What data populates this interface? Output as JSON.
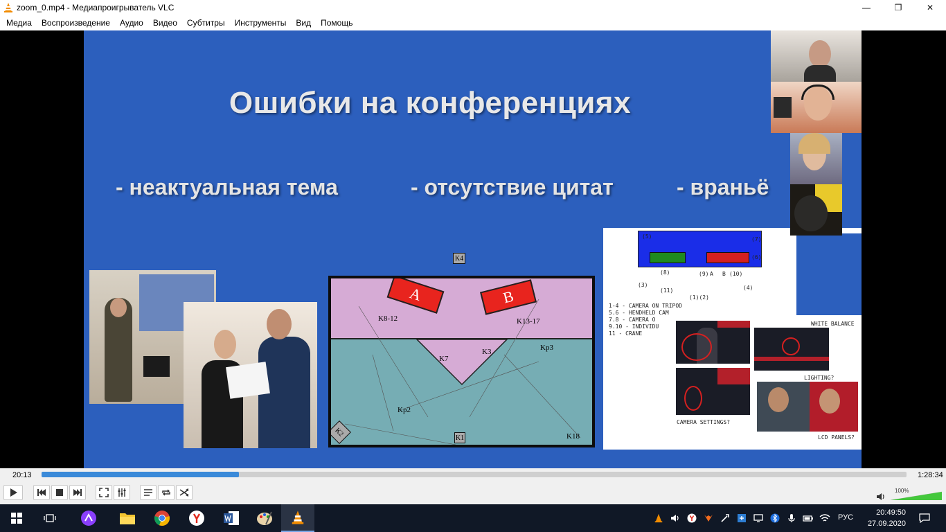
{
  "window": {
    "title": "zoom_0.mp4 - Медиапроигрыватель VLC",
    "minimize_glyph": "—",
    "maximize_glyph": "❐",
    "close_glyph": "✕"
  },
  "menu": {
    "items": [
      "Медиа",
      "Воспроизведение",
      "Аудио",
      "Видео",
      "Субтитры",
      "Инструменты",
      "Вид",
      "Помощь"
    ]
  },
  "slide": {
    "title": "Ошибки на конференциях",
    "bullets": [
      "- неактуальная тема",
      "- отсутствие цитат",
      "- враньё"
    ],
    "diagram": {
      "stage_a": "A",
      "stage_b": "B",
      "labels": [
        "K4",
        "K8-12",
        "K13-17",
        "K7",
        "K3",
        "Kp3",
        "Kp2",
        "K2",
        "K1",
        "K18"
      ]
    },
    "collage": {
      "numbers": [
        "(5)",
        "(7)",
        "(6)",
        "(8)",
        "(9)",
        "A",
        "B",
        "(10)",
        "(3)",
        "(11)",
        "(4)",
        "(1)(2)"
      ],
      "legend": [
        "1-4 - CAMERA ON TRIPOD",
        "5.6 - HENDHELD CAM",
        "7.8 - CAMERA O",
        "9.10 - INDIVIDU",
        "11 - CRANE"
      ],
      "captions": [
        "WHITE BALANCE",
        "LIGHTING?",
        "CAMERA SETTINGS?",
        "LCD PANELS?"
      ]
    }
  },
  "player": {
    "time_elapsed": "20:13",
    "time_total": "1:28:34",
    "progress": 0.2284,
    "volume_label": "100%",
    "volume": 1.0
  },
  "taskbar": {
    "language": "РУС",
    "time": "20:49:50",
    "date": "27.09.2020"
  },
  "colors": {
    "slide_blue": "#2c5fbd",
    "seek_fill": "#3a8ad9",
    "vlc_orange": "#f28c00",
    "taskbar": "#101826"
  }
}
